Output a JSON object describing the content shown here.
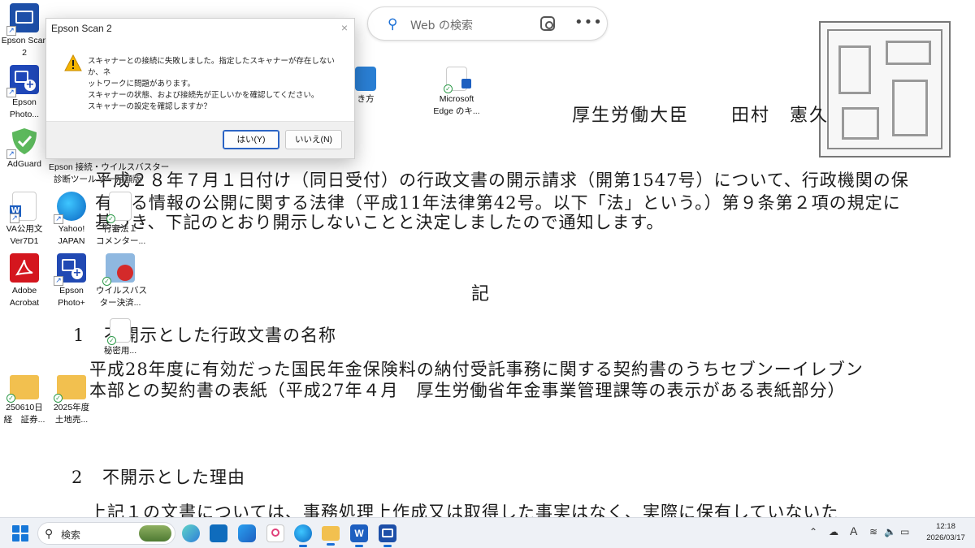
{
  "desktop": {
    "icons": [
      {
        "label_l1": "Epson Scan",
        "label_l2": "2"
      },
      {
        "label_l1": "Epson",
        "label_l2": "Photo..."
      },
      {
        "label_l1": "AdGuard",
        "label_l2": ""
      },
      {
        "label_l1": "Epson 接続・ウイルスバスター",
        "label_l2": "診断ツール ター月額版"
      },
      {
        "label_l1": "VA公用文",
        "label_l2": "Ver7D1"
      },
      {
        "label_l1": "Yahoo!",
        "label_l2": "JAPAN"
      },
      {
        "label_l1": "行審法１",
        "label_l2": "コメンター..."
      },
      {
        "label_l1": "Adobe",
        "label_l2": "Acrobat"
      },
      {
        "label_l1": "Epson",
        "label_l2": "Photo+"
      },
      {
        "label_l1": "ウイルスバス",
        "label_l2": "ター決済..."
      },
      {
        "label_l1": "秘密用",
        "label_l2": "..."
      },
      {
        "label_l1": "250610日",
        "label_l2": "経　証券..."
      },
      {
        "label_l1": "2025年度",
        "label_l2": "土地売..."
      },
      {
        "label_l1": "Microsoft",
        "label_l2": "Edge のキ..."
      },
      {
        "label_l1": "き方",
        "label_l2": ""
      }
    ]
  },
  "web_search": {
    "placeholder": "Web の検索"
  },
  "dialog": {
    "title": "Epson Scan 2",
    "close": "×",
    "message_lines": [
      "スキャナーとの接続に失敗しました。指定したスキャナーが存在しないか、ネ",
      "ットワークに問題があります。",
      "スキャナーの状態、および接続先が正しいかを確認してください。",
      "スキャナーの設定を確認しますか？"
    ],
    "yes_label": "はい(Y)",
    "no_label": "いいえ(N)"
  },
  "document": {
    "minister_title": "厚生労働大臣",
    "minister_name": "田村　憲久",
    "para_lines": [
      "平成２８年７月１日付け（同日受付）の行政文書の開示請求（開第1547号）について、行政機関の保",
      "有する情報の公開に関する法律（平成11年法律第42号。以下「法」という。）第９条第２項の規定に",
      "基づき、下記のとおり開示しないことと決定しましたので通知します。"
    ],
    "ki": "記",
    "section1_num": "1",
    "section1_title": "不開示とした行政文書の名称",
    "section1_lines": [
      "平成28年度に有効だった国民年金保険料の納付受託事務に関する契約書のうちセブンーイレブン",
      "本部との契約書の表紙（平成27年４月　厚生労働省年金事業管理課等の表示がある表紙部分）"
    ],
    "section2_num": "2",
    "section2_title": "不開示とした理由",
    "section2_line": "上記１の文書については、事務処理上作成又は取得した事実はなく、実際に保有していないた"
  },
  "taskbar": {
    "search_label": "検索",
    "time": "12:18",
    "date": "2026/03/17",
    "ime": "A"
  }
}
